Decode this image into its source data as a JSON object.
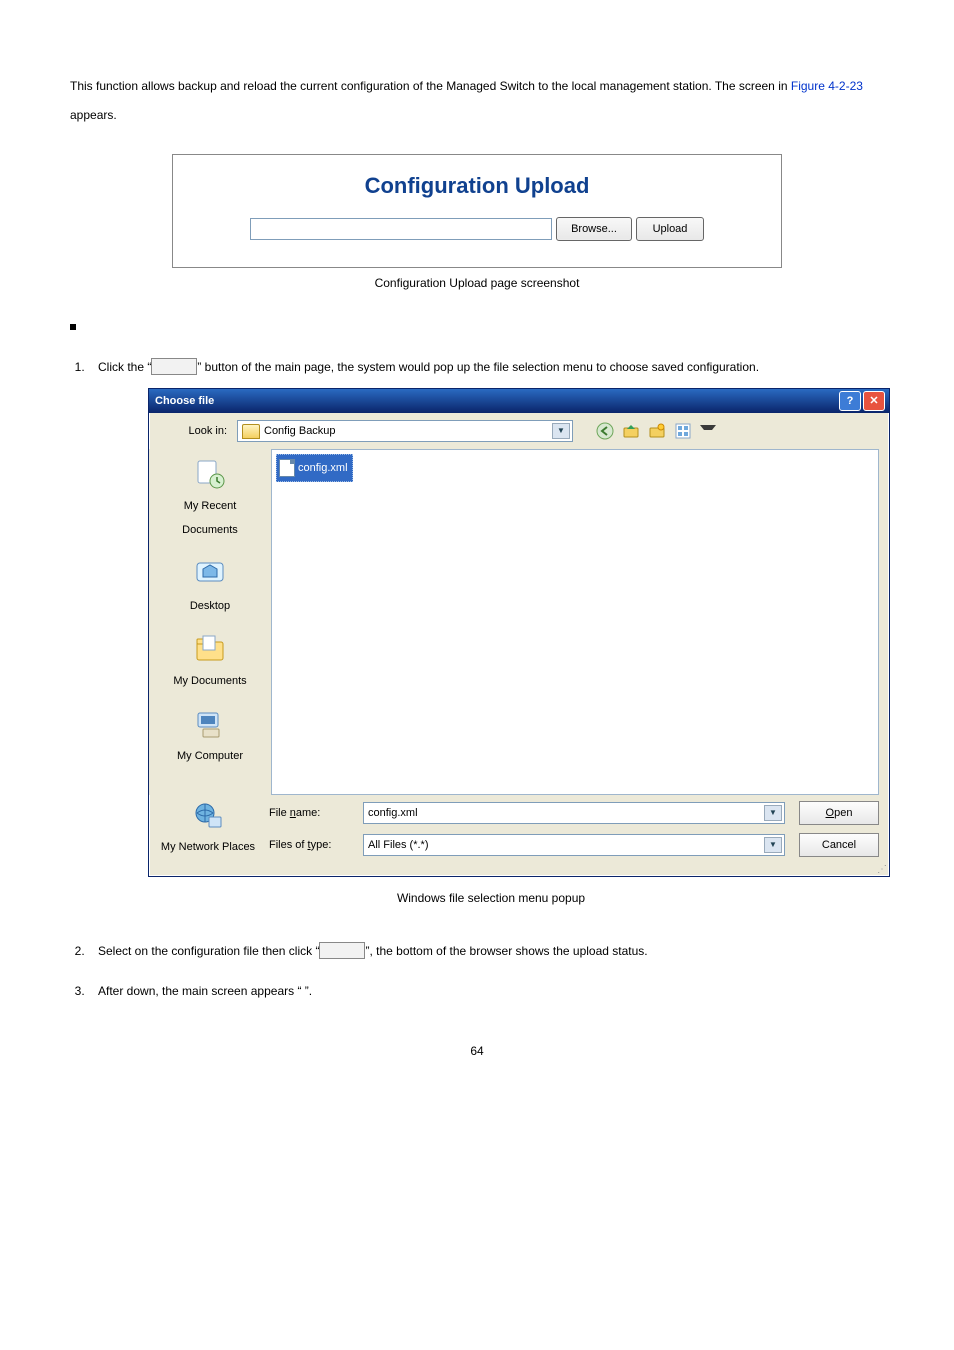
{
  "intro": {
    "part1": "This function allows backup and reload the current configuration of the Managed Switch to the local management station. The screen in ",
    "link": "Figure 4-2-23",
    "part2": " appears."
  },
  "upload_panel": {
    "title": "Configuration Upload",
    "browse_label": "Browse...",
    "upload_label": "Upload"
  },
  "caption1": "Configuration Upload page screenshot",
  "step1_a": "Click the “",
  "step1_b": "” button of the main page, the system would pop up the file selection menu to choose saved configuration.",
  "choose_file": {
    "title": "Choose file",
    "lookin_label": "Look in:",
    "lookin_value": "Config Backup",
    "file_selected": "config.xml",
    "places": {
      "recent": "My Recent Documents",
      "desktop": "Desktop",
      "mydocs": "My Documents",
      "mycomp": "My Computer",
      "network": "My Network Places"
    },
    "filename_label": "File name:",
    "filename_value": "config.xml",
    "filetype_label": "Files of type:",
    "filetype_value": "All Files (*.*)",
    "open_label": "Open",
    "cancel_label": "Cancel"
  },
  "caption2": "Windows file selection menu popup",
  "step2_a": "Select on the configuration file then click “",
  "step2_b": "”, the bottom of the browser shows the upload status.",
  "step3": "After down, the main screen appears “                                       ”.",
  "page_number": "64"
}
